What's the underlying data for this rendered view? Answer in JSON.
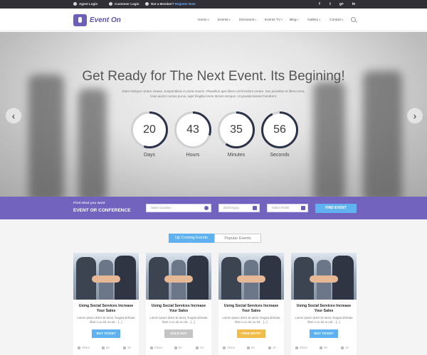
{
  "topbar": {
    "agent_login": "Agent Login",
    "customer_login": "Customer Login",
    "member_prompt": "Not a Member?",
    "register": "Register Now",
    "social": [
      {
        "icon": "facebook-icon",
        "glyph": "f"
      },
      {
        "icon": "twitter-icon",
        "glyph": "t"
      },
      {
        "icon": "google-plus-icon",
        "glyph": "g+"
      },
      {
        "icon": "linkedin-icon",
        "glyph": "in"
      }
    ]
  },
  "header": {
    "logo": "Event On",
    "nav": [
      "Home",
      "Events",
      "Directions",
      "Events TV",
      "Blog",
      "Gallery",
      "Contact"
    ]
  },
  "hero": {
    "title": "Get Ready for The Next Event. Its Begining!",
    "description": "Diam tristique ornare massa. Suspendisse in porta mauris. Phasellus quis libero vel tincidunt ornare. Sus pendisse et libero urna. Cras auctor cursus purus, eget fringilla lorem dictum tempus. Ut gravida laoreet hendrerit.",
    "countdown": [
      {
        "value": "20",
        "label": "Days",
        "progress": 0.55
      },
      {
        "value": "43",
        "label": "Hours",
        "progress": 0.3
      },
      {
        "value": "35",
        "label": "Minutes",
        "progress": 0.6
      },
      {
        "value": "56",
        "label": "Seconds",
        "progress": 0.93
      }
    ],
    "prev_icon": "chevron-left-icon",
    "next_icon": "chevron-right-icon"
  },
  "search": {
    "label_small": "Find what you want",
    "label_big": "EVENT OR CONFERENCE",
    "location_placeholder": "Select Location",
    "date_placeholder": "dd/mm/yyyy",
    "fields_placeholder": "Select Fields",
    "button": "FIND EVENT"
  },
  "events": {
    "tabs": {
      "active": "Up Coming Events",
      "inactive": "Popular Events"
    },
    "cards": [
      {
        "title": "Using Social Services Increase Your Sales",
        "desc": "Lorem ipsum dolor sit amet, feugiat delicata liber o cu sit, eu sit... [...]",
        "button": "BUY TICKET",
        "button_color": "#5fb2ef",
        "share": "Share",
        "likes": "56",
        "comments": "18"
      },
      {
        "title": "Using Social Services Increase Your Sales",
        "desc": "Lorem ipsum dolor sit amet, feugiat delicata liber o cu sit, eu sit... [...]",
        "button": "SOLD OUT",
        "button_color": "#c4c4c4",
        "share": "Share",
        "likes": "56",
        "comments": "18"
      },
      {
        "title": "Using Social Services Increase Your Sales",
        "desc": "Lorem ipsum dolor sit amet, feugiat delicata liber o cu sit, eu sit... [...]",
        "button": "FREE ENTRY",
        "button_color": "#f0bd4c",
        "share": "Share",
        "likes": "56",
        "comments": "18"
      },
      {
        "title": "Using Social Services Increase Your Sales",
        "desc": "Lorem ipsum dolor sit amet, feugiat delicata liber o cu sit, eu sit... [...]",
        "button": "BUY TICKET",
        "button_color": "#5fb2ef",
        "share": "Share",
        "likes": "56",
        "comments": "18"
      }
    ]
  },
  "colors": {
    "brand": "#6c5fb8",
    "accent": "#5fb2ef",
    "topbar": "#2f2f35"
  }
}
